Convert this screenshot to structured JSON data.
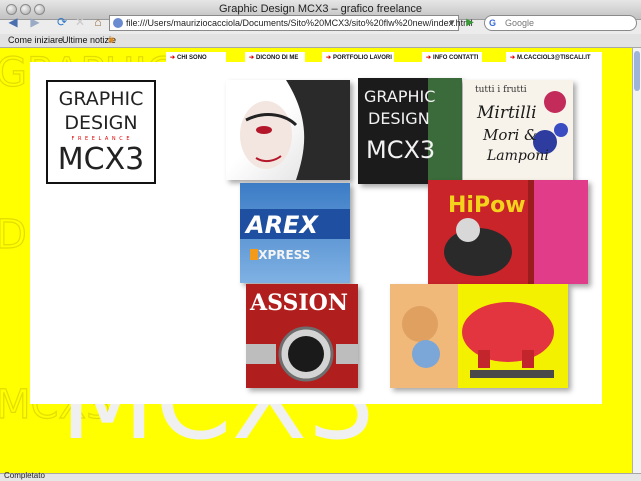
{
  "window": {
    "title": "Graphic Design MCX3 – grafico freelance"
  },
  "toolbar": {
    "url": "file:///Users/mauriziocacciola/Documents/Sito%20MCX3/sito%20flw%20new/index.html",
    "search_placeholder": "Google",
    "search_engine_letter": "G"
  },
  "bookmarks": [
    "Come iniziare",
    "Ultime notizie"
  ],
  "nav": {
    "items": [
      "CHI SONO",
      "DICONO DI ME",
      "PORTFOLIO LAVORI",
      "INFO CONTATTI",
      "M.CACCIOL3@TISCALI.IT"
    ]
  },
  "logo": {
    "line1": "GRAPHIC",
    "line2": "DESIGN",
    "tagline": "F R E E L A N C E",
    "line3": "MCX3"
  },
  "tiles": {
    "arex": {
      "word": "AREX",
      "word2": "EXPRESS"
    },
    "mcx3": {
      "line1": "GRAPHIC",
      "line2": "DESIGN",
      "line3": "MCX3"
    },
    "tutti": {
      "line1": "tutti i frutti",
      "line2": "Mirtilli",
      "line3": "Mori &",
      "line4": "Lamponi"
    },
    "hipow": {
      "word": "HiPow"
    },
    "passion": {
      "word": "ASSION"
    }
  },
  "background_text": {
    "big": [
      "GRAPHIC",
      "DESIGN",
      "MCX3"
    ],
    "freelance": "F R E E L A N C E"
  },
  "status": {
    "text": "Completato"
  },
  "colors": {
    "accent": "#ffff00",
    "nav_arrow": "#e00000"
  }
}
